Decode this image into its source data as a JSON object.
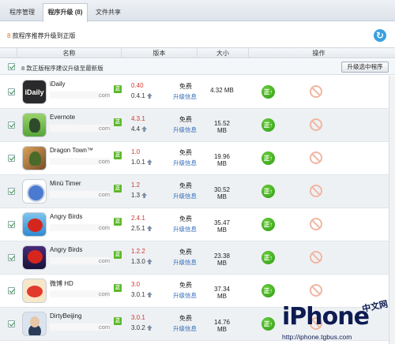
{
  "tabs": [
    {
      "label": "程序管理"
    },
    {
      "label": "程序升级 (8)"
    },
    {
      "label": "文件共享"
    }
  ],
  "summary": {
    "count": "8",
    "text": "款程序推荐升级到正版"
  },
  "table_headers": {
    "name": "名称",
    "version": "版本",
    "size": "大小",
    "action": "操作"
  },
  "notice": {
    "count": "8",
    "text": "款正版程序建议升级至最新版",
    "button": "升级选中程序"
  },
  "badge_label": "正",
  "go_label": "正↑",
  "apps": [
    {
      "name": "iDaily",
      "icon": "idaily-icon",
      "icon_text": "iDaily",
      "url": "com",
      "v_new": "0.40",
      "v_old": "0.4.1",
      "price": "免费",
      "info": "升级信息",
      "size": "4.32 MB"
    },
    {
      "name": "Evernote",
      "icon": "evernote-icon",
      "url": "com",
      "v_new": "4.3.1",
      "v_old": "4.4",
      "price": "免费",
      "info": "升级信息",
      "size": "15.52 MB"
    },
    {
      "name": "Dragon Town™",
      "icon": "dragon-town-icon",
      "url": "com",
      "v_new": "1.0",
      "v_old": "1.0.1",
      "price": "免费",
      "info": "升级信息",
      "size": "19.96 MB"
    },
    {
      "name": "Minü Timer",
      "icon": "timer-icon",
      "url": "com",
      "v_new": "1.2",
      "v_old": "1.3",
      "price": "免费",
      "info": "升级信息",
      "size": "30.52 MB"
    },
    {
      "name": "Angry Birds",
      "icon": "angry-birds-hd-icon",
      "url": "com",
      "v_new": "2.4.1",
      "v_old": "2.5.1",
      "price": "免费",
      "info": "升级信息",
      "size": "35.47 MB"
    },
    {
      "name": "Angry Birds",
      "icon": "angry-birds-space-icon",
      "url": "com",
      "v_new": "1.2.2",
      "v_old": "1.3.0",
      "price": "免费",
      "info": "升级信息",
      "size": "23.38 MB"
    },
    {
      "name": "微博 HD",
      "icon": "weibo-icon",
      "url": "com",
      "v_new": "3.0",
      "v_old": "3.0.1",
      "price": "免费",
      "info": "升级信息",
      "size": "37.34 MB"
    },
    {
      "name": "DirtyBeijing",
      "icon": "dirtybeijing-icon",
      "url": "com",
      "v_new": "3.0.1",
      "v_old": "3.0.2",
      "price": "免费",
      "info": "升级信息",
      "size": "14.76 MB"
    }
  ],
  "watermark": {
    "logo": "iPhone",
    "cn": "中文网",
    "url": "http://iphone.tgbus.com"
  },
  "colors": {
    "accent": "#2f6ab8",
    "version_new": "#d03a2e",
    "go_green": "#3aa020",
    "summary_num": "#e07020"
  }
}
